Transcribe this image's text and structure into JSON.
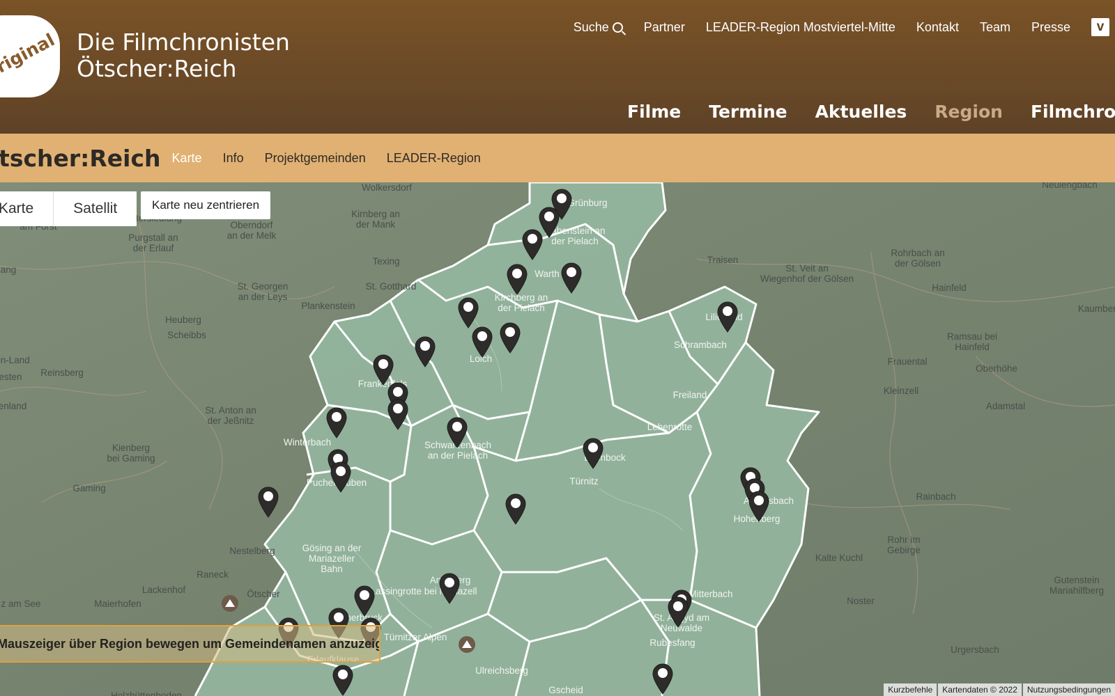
{
  "logo": {
    "badge_text": "Original"
  },
  "site": {
    "title_line1": "Die Filmchronisten",
    "title_line2": "Ötscher:Reich"
  },
  "top_nav": {
    "search": "Suche",
    "items": [
      "Partner",
      "LEADER-Region Mostviertel-Mitte",
      "Kontakt",
      "Team",
      "Presse"
    ],
    "vimeo_icon": "vimeo-icon"
  },
  "main_nav": {
    "items": [
      "Filme",
      "Termine",
      "Aktuelles",
      "Region",
      "Filmchronisten"
    ],
    "active": "Region"
  },
  "subnav": {
    "title": "Ötscher:Reich",
    "items": [
      "Karte",
      "Info",
      "Projektgemeinden",
      "LEADER-Region"
    ],
    "active": "Karte"
  },
  "map": {
    "type_buttons": [
      "Karte",
      "Satellit"
    ],
    "recenter_label": "Karte neu zentrieren",
    "hint": "Mauszeiger über Region bewegen um Gemeindenamen anzuzeigen.",
    "attribution": [
      "Kurzbefehle",
      "Kartendaten © 2022",
      "Nutzungsbedingungen"
    ],
    "colors": {
      "region_fill": "#94b59e",
      "outside": "#7b8a76",
      "pin": "#2e2c2a"
    },
    "places": {
      "wolkersdorf": "Wolkersdorf",
      "neulengbach": "Neulengbach",
      "amforst": "am Forst",
      "kirnberg": "Kirnberg an\nder Mank",
      "oberndorf": "Oberndorf\nan der Melk",
      "ratersiedlung": "ratersiedlung",
      "purgstall": "Purgstall an\nder Erlauf",
      "ang": "ang",
      "texing": "Texing",
      "stgeorgen": "St. Georgen\nan der Leys",
      "stgotthard": "St. Gotthard",
      "plankenstein": "Plankenstein",
      "heuberg": "Heuberg",
      "scheibbs": "Scheibbs",
      "enland": "en-Land",
      "esten": "esten",
      "reinsberg": "Reinsberg",
      "enland2": "enland",
      "stanton": "St. Anton an\nder Jeßnitz",
      "kienberg": "Kienberg\nbei Gaming",
      "gaming": "Gaming",
      "winterbach": "Winterbach",
      "puchenstuben": "Puchenstuben",
      "nestelberg": "Nestelberg",
      "raneck": "Raneck",
      "lackenhof": "Lackenhof",
      "oetscher": "Ötscher",
      "maierhofen": "Maierhofen",
      "zamsee": "z am See",
      "rabenstein": "Rabenstein an\nder Pielach",
      "grenburg": "Grünburg",
      "warth": "Warth",
      "kirchberg": "Kirchberg an\nder Pielach",
      "loich": "Loich",
      "frankenfels": "Frankenfels",
      "schwarzenbach": "Schwarzenbach\nan der Pielach",
      "goesing": "Gösing an der\nMariazeller\nBahn",
      "annaberg": "Annaberg",
      "lassingrotte": "Lassingrotte bei Mariazell",
      "wienerbruck": "Wienerbruck",
      "tuernitzeralpen": "Türnitzer Alpen",
      "erlaufklause": "Erlaufklause",
      "ulreichsberg": "Ulreichsberg",
      "holzhuettenboden": "Holzhüttenboden",
      "gscheid": "Gscheid",
      "traisen": "Traisen",
      "wiegenhof": "St. Veit an\nWiegenhof der Gölsen",
      "rohrbach": "Rohrbach an\nder Gölsen",
      "hainfeld": "Hainfeld",
      "kaumberg": "Kaumberg",
      "lilienfeld": "Lilienfeld",
      "schrambach": "Schrambach",
      "ramsau": "Ramsau bei\nHainfeld",
      "frauental": "Frauental",
      "oberhoehe": "Oberhöhe",
      "kleinzell": "Kleinzell",
      "adamstal": "Adamstal",
      "freiland": "Freiland",
      "lehenrotte": "Lehenrotte",
      "tuernitz": "Türnitz",
      "eckenbock": "Ekenbock",
      "anrasbach": "Annrasbach",
      "hohenberg": "Hohenberg",
      "rainbach": "Rainbach",
      "rohrimgebirge": "Rohr im\nGebirge",
      "kaltekuchl": "Kalte Kuchl",
      "gutenstein": "Gutenstein\nMariahilfberg",
      "mitterbach": "Mitterbach",
      "noster": "Noster",
      "staegyd": "St. Aegyd am\nNeuwalde",
      "rubesfang": "Rubesfang",
      "urgersbach": "Urgersbach"
    }
  }
}
